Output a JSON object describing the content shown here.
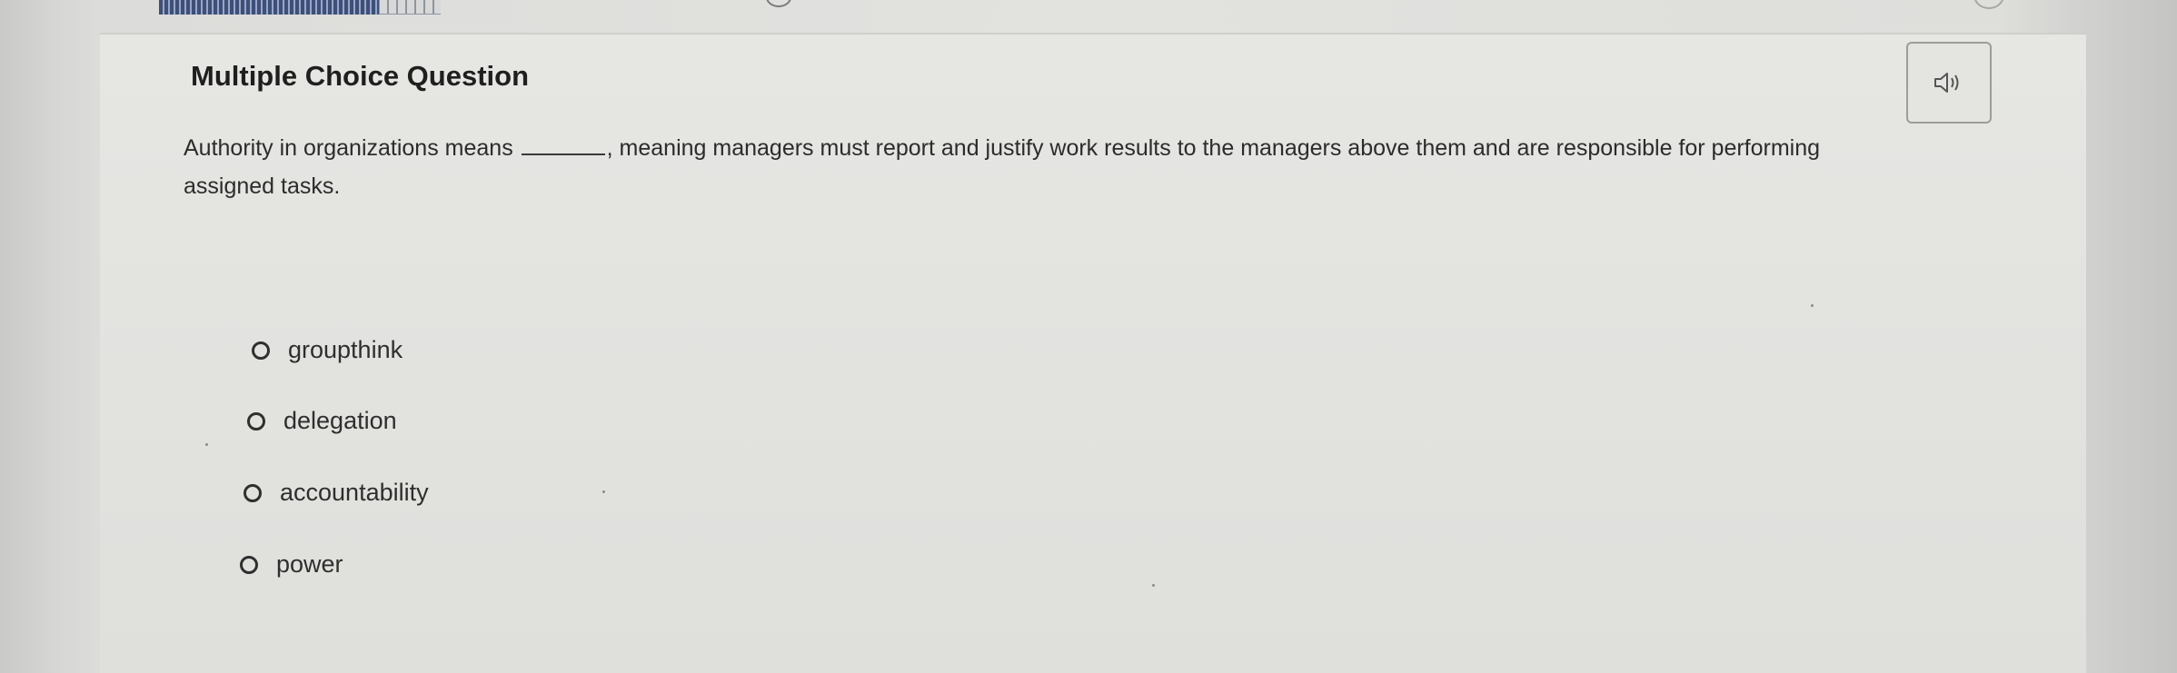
{
  "question": {
    "heading": "Multiple Choice Question",
    "prompt_before_blank": "Authority in organizations means ",
    "prompt_after_blank": ", meaning managers must report and justify work results to the managers above them and are responsible for performing assigned tasks.",
    "audio_icon": "speaker-icon"
  },
  "options": [
    {
      "label": "groupthink"
    },
    {
      "label": "delegation"
    },
    {
      "label": "accountability"
    },
    {
      "label": "power"
    }
  ],
  "colors": {
    "progress_fill": "#3d4f7a",
    "text": "#2c2c2c"
  }
}
